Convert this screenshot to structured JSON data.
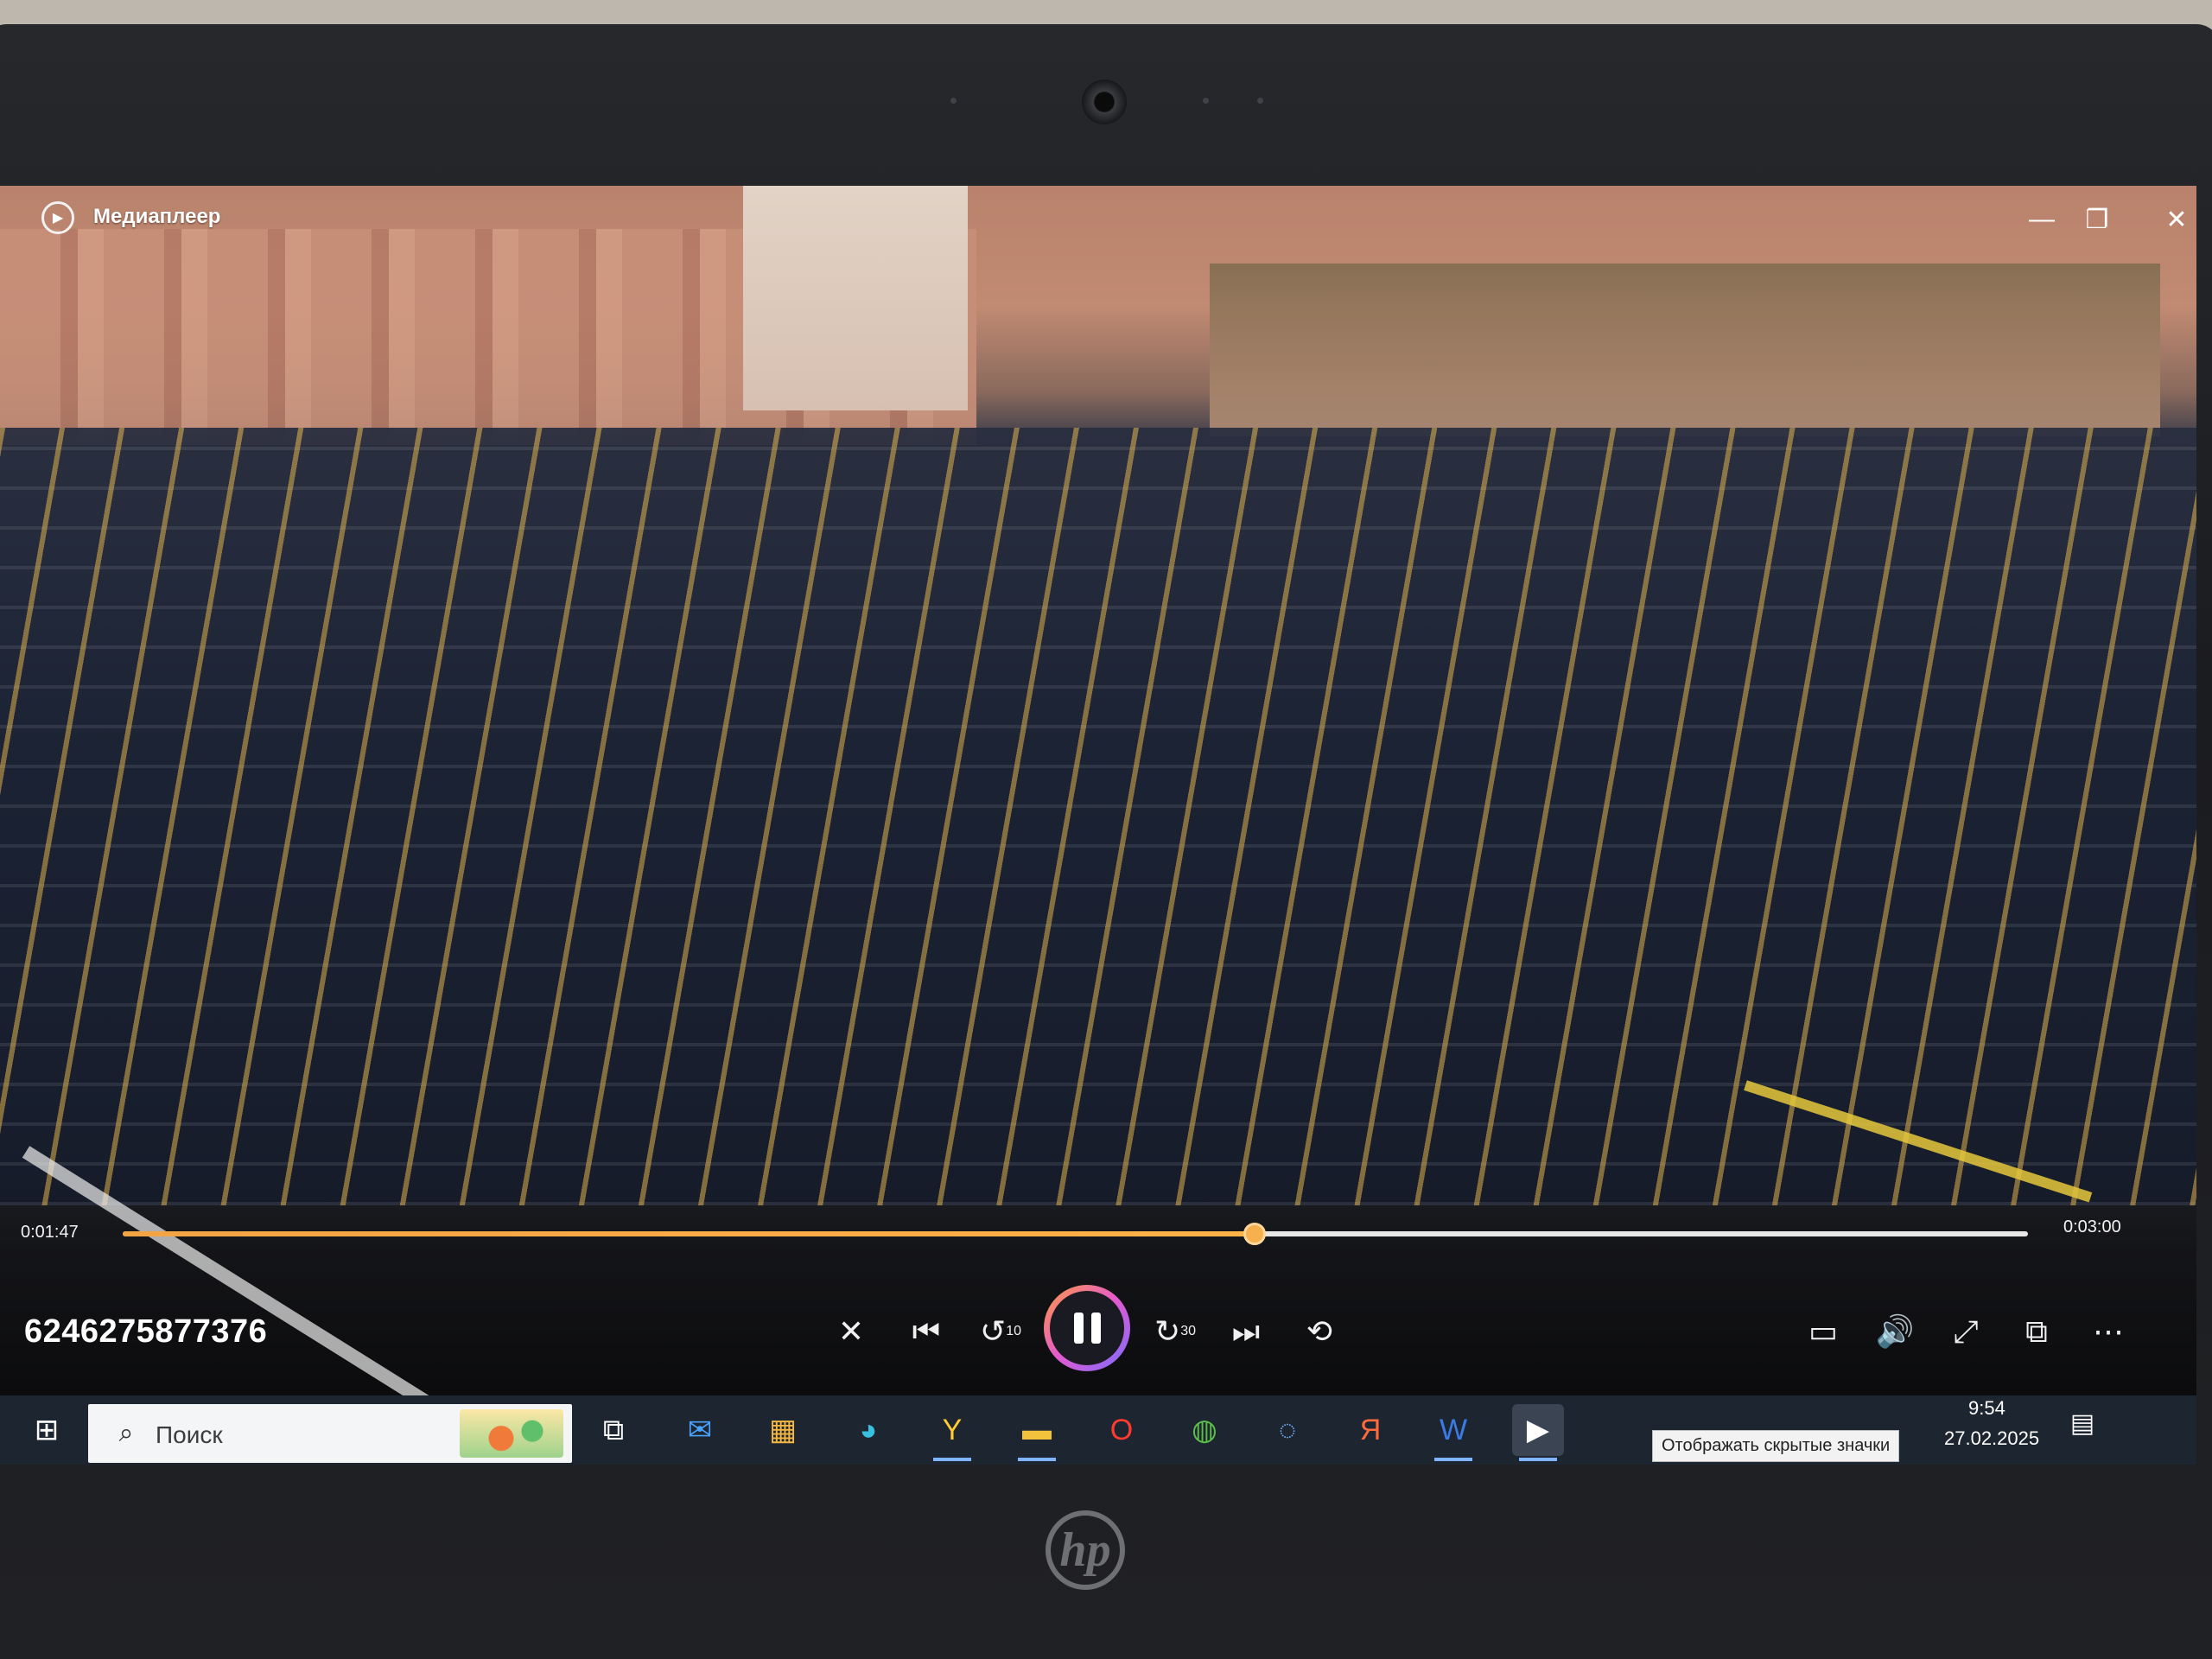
{
  "window": {
    "title": "Медиаплеер",
    "controls": {
      "minimize": "—",
      "restore": "❐",
      "close": "✕"
    }
  },
  "player": {
    "current_time": "0:01:47",
    "total_time": "0:03:00",
    "progress_fraction": 0.594,
    "file_name": "6246275877376",
    "icons": {
      "shuffle": "✕",
      "previous": "⏮",
      "rewind": "↺",
      "rewind_seconds": "10",
      "forward": "↻",
      "forward_seconds": "30",
      "next": "⏭",
      "repeat": "⟲",
      "miniplayer": "▭",
      "volume": "🔊",
      "fullscreen": "⤢",
      "cast": "⧉",
      "more": "⋯"
    },
    "accent": "#f7b04e"
  },
  "taskbar": {
    "search_placeholder": "Поиск",
    "tooltip": "Отображать скрытые значки",
    "clock_time": "9:54",
    "clock_date": "27.02.2025",
    "brand_label": "hp",
    "icons": {
      "start": "⊞",
      "search": "⌕",
      "task_view": "⧉",
      "mail": "✉",
      "store": "▦",
      "edge": "◕",
      "yandex_browser": "Y",
      "file_explorer": "▬",
      "opera": "O",
      "chrome": "◍",
      "chromium": "◌",
      "yandex": "Я",
      "word": "W",
      "media_player": "▶",
      "notifications": "▤"
    }
  }
}
